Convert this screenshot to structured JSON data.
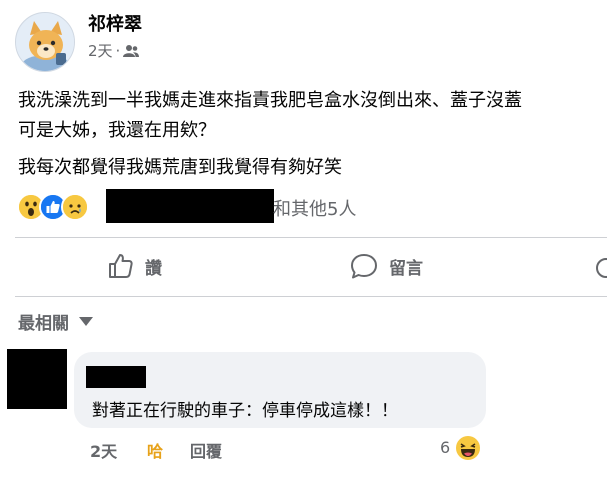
{
  "post": {
    "author": "祁梓翠",
    "time": "2天",
    "separator": "·",
    "audience_icon": "friends-icon",
    "lines": [
      "我洗澡洗到一半我媽走進來指責我肥皂盒水沒倒出來、蓋子沒蓋",
      "可是大姊，我還在用欸？",
      "我每次都覺得我媽荒唐到我覺得有夠好笑"
    ]
  },
  "reactions": {
    "icons": [
      "wow-emoji-icon",
      "like-icon",
      "sad-emoji-icon"
    ],
    "others_text": "和其他5人"
  },
  "actions": {
    "like_label": "讚",
    "comment_label": "留言"
  },
  "comments_header": {
    "sort_label": "最相關"
  },
  "comment": {
    "text": "對著正在行駛的車子：停車停成這樣！！",
    "time": "2天",
    "like_label": "哈",
    "reply_label": "回覆",
    "reaction_count": "6",
    "reaction_icon": "laugh-emoji-icon"
  },
  "colors": {
    "text": "#050505",
    "secondary": "#65676b",
    "like_blue": "#1877f2",
    "haha_orange": "#e7a21a",
    "bubble": "#f0f2f5"
  }
}
